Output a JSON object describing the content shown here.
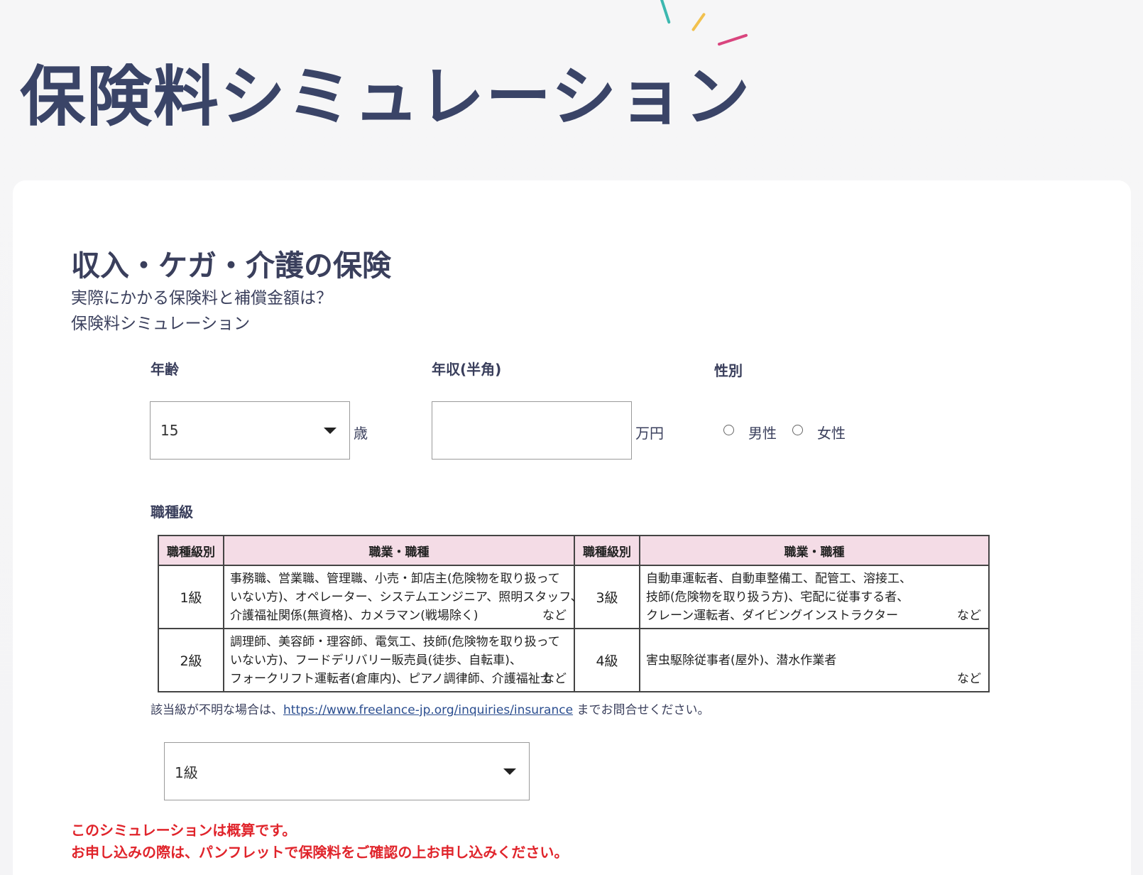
{
  "page_title": "保険料シミュレーション",
  "section": {
    "title": "収入・ケガ・介護の保険",
    "subtitle_line1": "実際にかかる保険料と補償金額は？",
    "subtitle_line2": "保険料シミュレーション"
  },
  "form": {
    "age": {
      "label": "年齢",
      "value": "15",
      "unit": "歳"
    },
    "income": {
      "label": "年収(半角)",
      "value": "",
      "unit": "万円"
    },
    "gender": {
      "label": "性別",
      "options": [
        "男性",
        "女性"
      ],
      "selected": null
    },
    "job_class": {
      "label": "職種級",
      "value": "1級"
    }
  },
  "job_table": {
    "headers": [
      "職種級別",
      "職業・職種",
      "職種級別",
      "職業・職種"
    ],
    "rows": [
      {
        "left_grade": "1級",
        "left_lines": [
          "事務職、営業職、管理職、小売・卸店主(危険物を取り扱って",
          "いない方)、オペレーター、システムエンジニア、照明スタッフ、",
          "介護福祉関係(無資格)、カメラマン(戦場除く)"
        ],
        "left_suffix": "など",
        "right_grade": "3級",
        "right_lines": [
          "自動車運転者、自動車整備工、配管工、溶接工、",
          "技師(危険物を取り扱う方)、宅配に従事する者、",
          "クレーン運転者、ダイビングインストラクター"
        ],
        "right_suffix": "など"
      },
      {
        "left_grade": "2級",
        "left_lines": [
          "調理師、美容師・理容師、電気工、技師(危険物を取り扱って",
          "いない方)、フードデリバリー販売員(徒歩、自転車)、",
          "フォークリフト運転者(倉庫内)、ピアノ調律師、介護福祉士"
        ],
        "left_suffix": "など",
        "right_grade": "4級",
        "right_lines": [
          "害虫駆除従事者(屋外)、潜水作業者"
        ],
        "right_suffix": "など"
      }
    ]
  },
  "notice": {
    "prefix": "該当級が不明な場合は、",
    "link": "https://www.freelance-jp.org/inquiries/insurance",
    "suffix": " までお問合せください。"
  },
  "warnings": {
    "line1": "このシミュレーションは概算です。",
    "line2": "お申し込みの際は、パンフレットで保険料をご確認の上お申し込みください。"
  },
  "colors": {
    "title": "#3a4467",
    "warning": "#e0242b",
    "table_header_bg": "#f4dce6",
    "link": "#2a4d8f"
  }
}
